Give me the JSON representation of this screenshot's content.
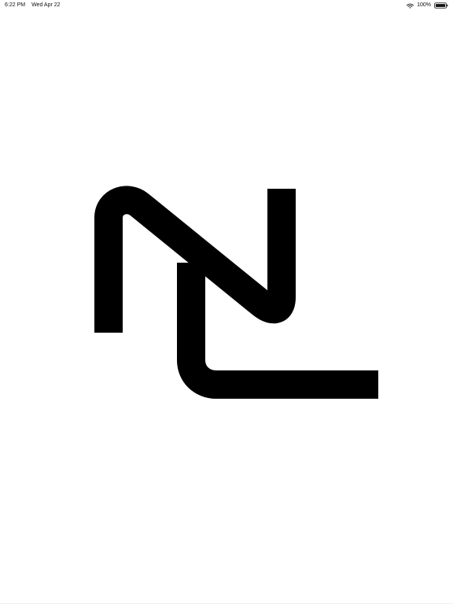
{
  "status_bar": {
    "time": "6:22 PM",
    "date": "Wed Apr 22",
    "battery": "100%",
    "wifi_icon": "wifi-icon",
    "battery_icon": "battery-icon"
  },
  "logo": {
    "icon": "nl-monogram-logo-icon",
    "color": "#000000"
  }
}
